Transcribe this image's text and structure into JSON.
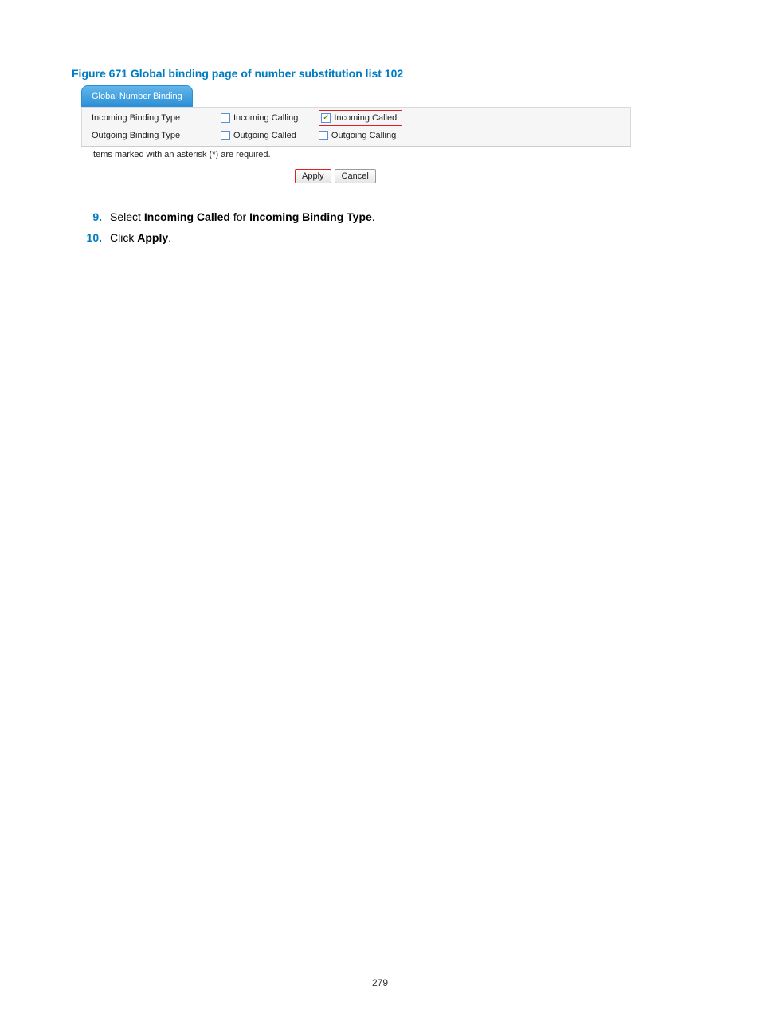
{
  "caption": "Figure 671 Global binding page of number substitution list 102",
  "tabTitle": "Global Number Binding",
  "row1": {
    "label": "Incoming Binding Type",
    "opt1": {
      "label": "Incoming Calling",
      "checked": false
    },
    "opt2": {
      "label": "Incoming Called",
      "checked": true,
      "highlight": true
    }
  },
  "row2": {
    "label": "Outgoing Binding Type",
    "opt1": {
      "label": "Outgoing Called",
      "checked": false
    },
    "opt2": {
      "label": "Outgoing Calling",
      "checked": false
    }
  },
  "note": "Items marked with an asterisk (*) are required.",
  "buttons": {
    "apply": "Apply",
    "cancel": "Cancel"
  },
  "steps": [
    {
      "num": "9.",
      "pre": "Select ",
      "b1": "Incoming Called",
      "mid": " for ",
      "b2": "Incoming Binding Type",
      "post": "."
    },
    {
      "num": "10.",
      "pre": "Click ",
      "b1": "Apply",
      "mid": "",
      "b2": "",
      "post": "."
    }
  ],
  "pageNumber": "279"
}
